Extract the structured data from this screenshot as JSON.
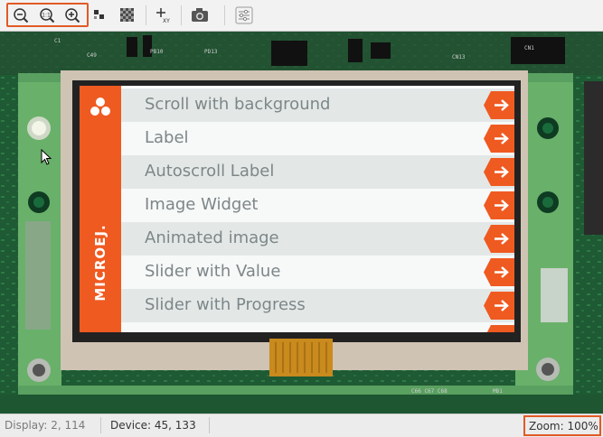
{
  "toolbar": {
    "items": [
      {
        "name": "zoom-out-icon"
      },
      {
        "name": "zoom-reset-icon"
      },
      {
        "name": "zoom-in-icon"
      },
      {
        "name": "pixel-grid-icon"
      },
      {
        "name": "checker-pattern-icon"
      },
      {
        "name": "xy-coordinates-icon",
        "text": "XY"
      },
      {
        "name": "camera-icon"
      },
      {
        "name": "sliders-icon"
      }
    ],
    "accent": "#e15a26"
  },
  "device": {
    "brand": "MICROEJ.",
    "brand_color": "#ef5a21",
    "list_items": [
      {
        "label": "Scroll with background"
      },
      {
        "label": "Label"
      },
      {
        "label": "Autoscroll Label"
      },
      {
        "label": "Image Widget"
      },
      {
        "label": "Animated image"
      },
      {
        "label": "Slider with Value"
      },
      {
        "label": "Slider with Progress"
      }
    ]
  },
  "status": {
    "display": "Display: 2, 114",
    "device": "Device: 45, 133",
    "zoom": "Zoom: 100%"
  }
}
